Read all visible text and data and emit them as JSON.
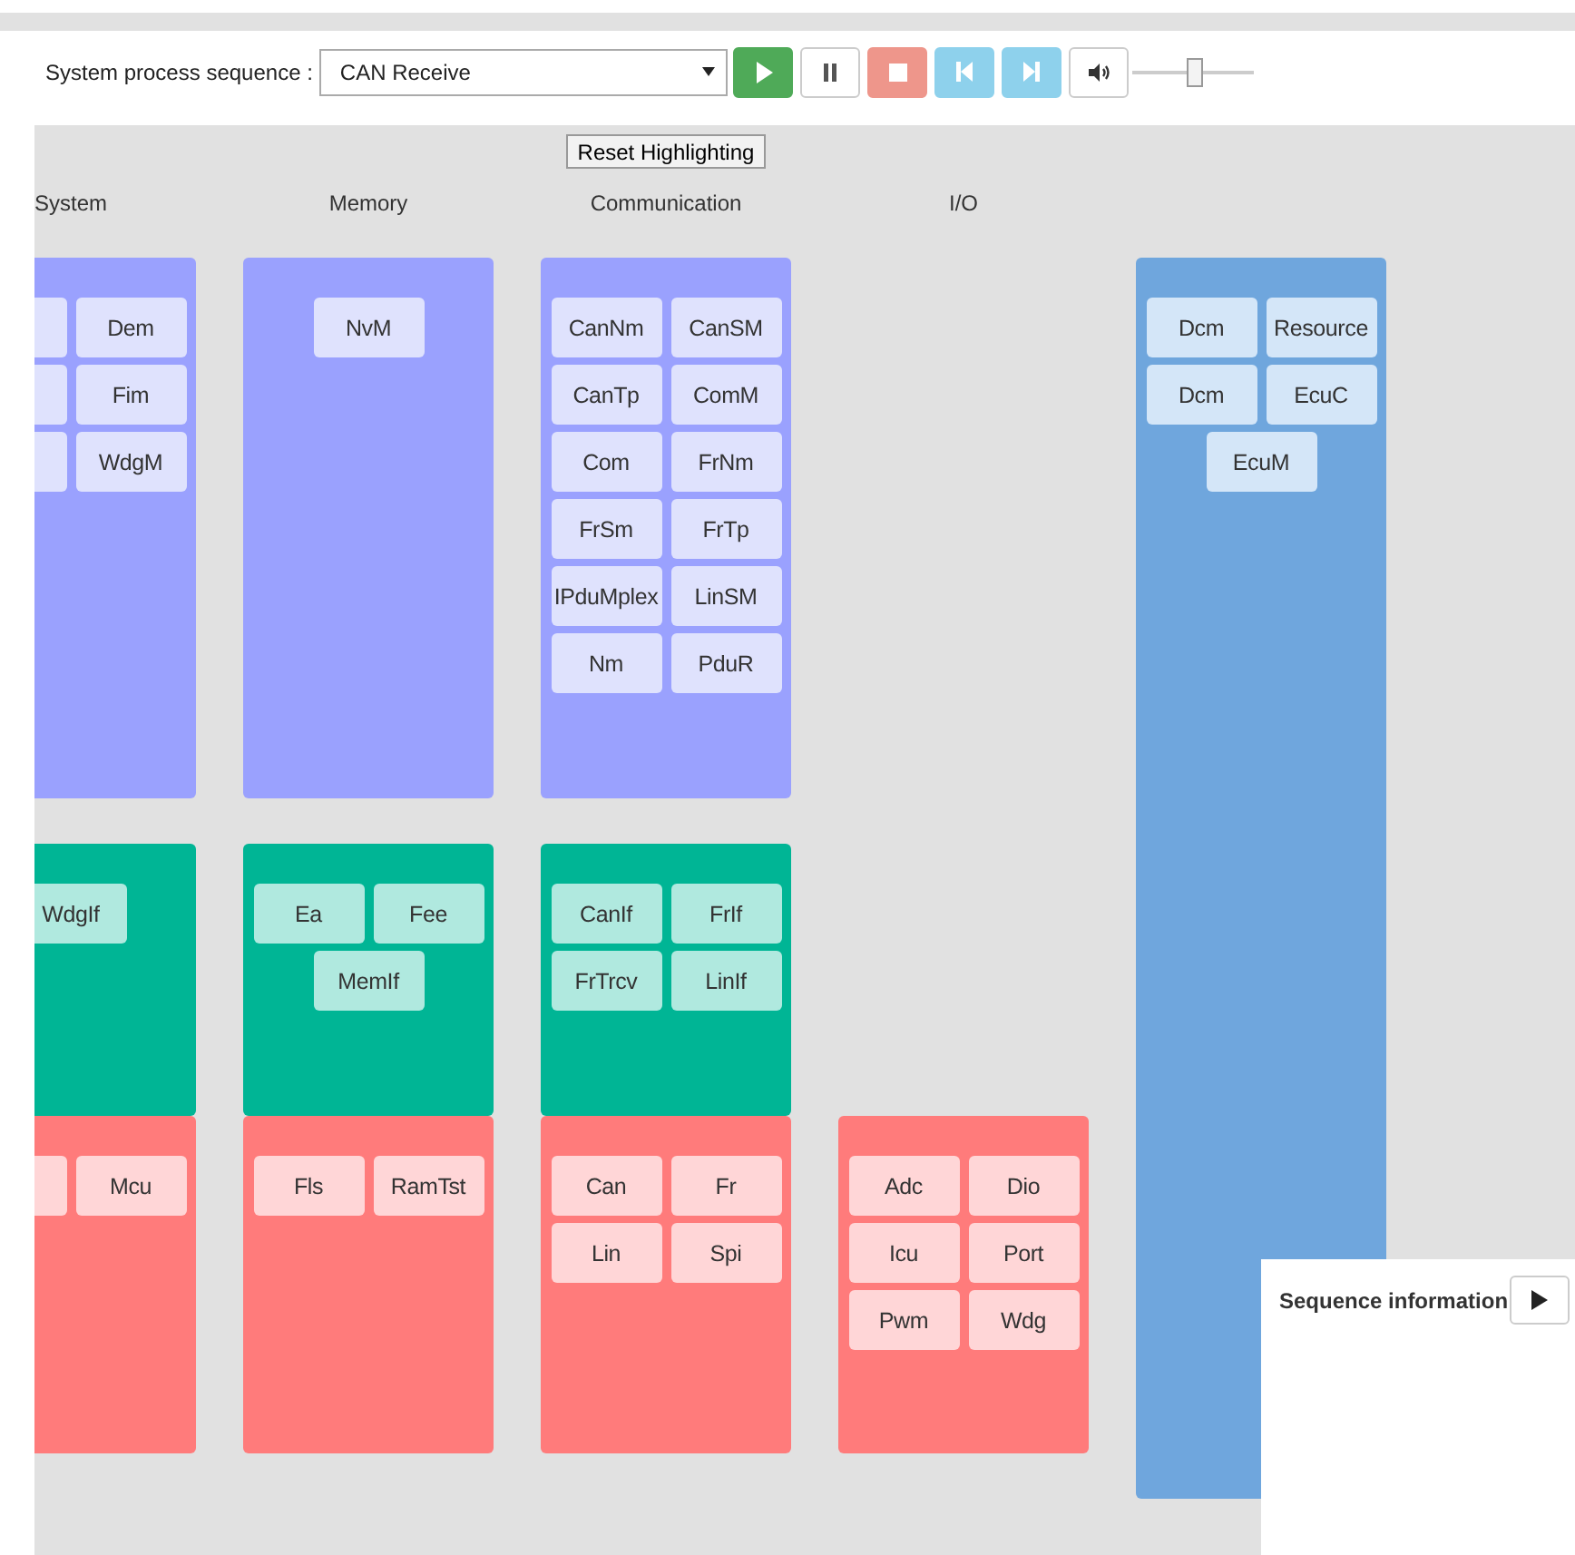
{
  "toolbar": {
    "label": "System process sequence :",
    "sequence": {
      "value": "CAN Receive"
    },
    "buttons": [
      {
        "kind": "play"
      },
      {
        "kind": "pause"
      },
      {
        "kind": "stop"
      },
      {
        "kind": "previous"
      },
      {
        "kind": "next"
      },
      {
        "kind": "volume"
      }
    ],
    "volume": {
      "level": 0.5
    }
  },
  "reset_button": {
    "label": "Reset Highlighting"
  },
  "columns": [
    {
      "header": "System",
      "layers": [
        {
          "kind": "services",
          "modules": [
            {
              "kind": "blank"
            },
            {
              "kind": "module",
              "label": "Dem"
            },
            {
              "kind": "blank"
            },
            {
              "kind": "module",
              "label": "Fim"
            },
            {
              "kind": "blank"
            },
            {
              "kind": "module",
              "label": "WdgM"
            }
          ]
        },
        {
          "kind": "abstraction",
          "modules": [
            {
              "kind": "module",
              "label": "WdgIf"
            }
          ]
        },
        {
          "kind": "drivers",
          "modules": [
            {
              "kind": "blank"
            },
            {
              "kind": "module",
              "label": "Mcu"
            }
          ]
        }
      ]
    },
    {
      "header": "Memory",
      "layers": [
        {
          "kind": "services",
          "modules": [
            {
              "kind": "module",
              "label": "NvM"
            }
          ]
        },
        {
          "kind": "abstraction",
          "modules": [
            {
              "kind": "module",
              "label": "Ea"
            },
            {
              "kind": "module",
              "label": "Fee"
            },
            {
              "kind": "module",
              "label": "MemIf"
            }
          ]
        },
        {
          "kind": "drivers",
          "modules": [
            {
              "kind": "module",
              "label": "Fls"
            },
            {
              "kind": "module",
              "label": "RamTst"
            }
          ]
        }
      ]
    },
    {
      "header": "Communication",
      "layers": [
        {
          "kind": "services",
          "modules": [
            {
              "kind": "module",
              "label": "CanNm"
            },
            {
              "kind": "module",
              "label": "CanSM"
            },
            {
              "kind": "module",
              "label": "CanTp"
            },
            {
              "kind": "module",
              "label": "ComM"
            },
            {
              "kind": "module",
              "label": "Com"
            },
            {
              "kind": "module",
              "label": "FrNm"
            },
            {
              "kind": "module",
              "label": "FrSm"
            },
            {
              "kind": "module",
              "label": "FrTp"
            },
            {
              "kind": "module",
              "label": "IPduMplex"
            },
            {
              "kind": "module",
              "label": "LinSM"
            },
            {
              "kind": "module",
              "label": "Nm"
            },
            {
              "kind": "module",
              "label": "PduR"
            }
          ]
        },
        {
          "kind": "abstraction",
          "modules": [
            {
              "kind": "module",
              "label": "CanIf"
            },
            {
              "kind": "module",
              "label": "FrIf"
            },
            {
              "kind": "module",
              "label": "FrTrcv"
            },
            {
              "kind": "module",
              "label": "LinIf"
            }
          ]
        },
        {
          "kind": "drivers",
          "modules": [
            {
              "kind": "module",
              "label": "Can"
            },
            {
              "kind": "module",
              "label": "Fr"
            },
            {
              "kind": "module",
              "label": "Lin"
            },
            {
              "kind": "module",
              "label": "Spi"
            }
          ]
        }
      ]
    },
    {
      "header": "I/O",
      "layers": [
        {
          "kind": "drivers",
          "modules": [
            {
              "kind": "module",
              "label": "Adc"
            },
            {
              "kind": "module",
              "label": "Dio"
            },
            {
              "kind": "module",
              "label": "Icu"
            },
            {
              "kind": "module",
              "label": "Port"
            },
            {
              "kind": "module",
              "label": "Pwm"
            },
            {
              "kind": "module",
              "label": "Wdg"
            }
          ]
        }
      ]
    },
    {
      "layers": [
        {
          "kind": "ecu",
          "modules": [
            {
              "kind": "module",
              "label": "Dcm"
            },
            {
              "kind": "module",
              "label": "Resource"
            },
            {
              "kind": "module",
              "label": "Dcm"
            },
            {
              "kind": "module",
              "label": "EcuC"
            },
            {
              "kind": "module",
              "label": "EcuM"
            }
          ]
        }
      ]
    }
  ],
  "sequence_panel": {
    "title": "Sequence information"
  }
}
